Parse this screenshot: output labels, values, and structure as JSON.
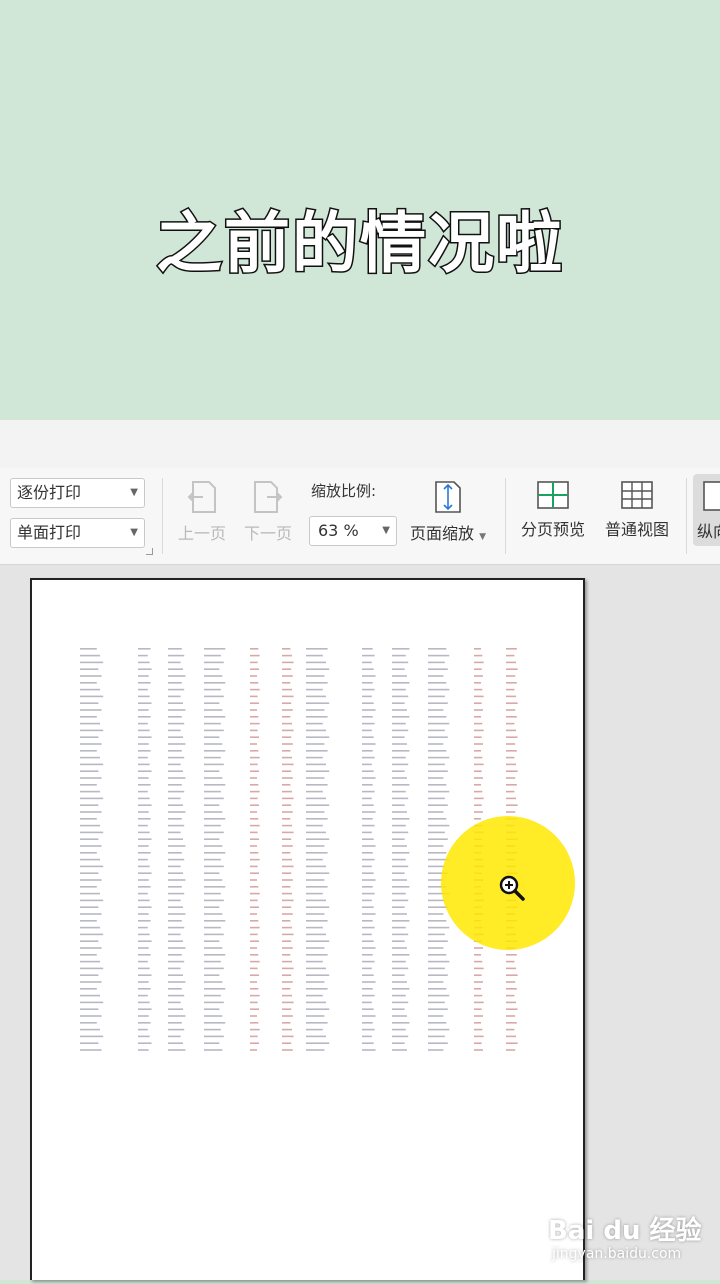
{
  "caption": "之前的情况啦",
  "toolbar": {
    "collate_select": "逐份打印",
    "sides_select": "单面打印",
    "prev_page": "上一页",
    "next_page": "下一页",
    "zoom_label": "缩放比例:",
    "zoom_value": "63 %",
    "page_zoom": "页面缩放",
    "page_break_preview": "分页预览",
    "normal_view": "普通视图",
    "portrait": "纵向"
  },
  "watermark": {
    "brand": "Bai du 经验",
    "url": "jingyan.baidu.com"
  },
  "colors": {
    "banner": "#d0e6d6",
    "highlight": "#ffe800"
  }
}
